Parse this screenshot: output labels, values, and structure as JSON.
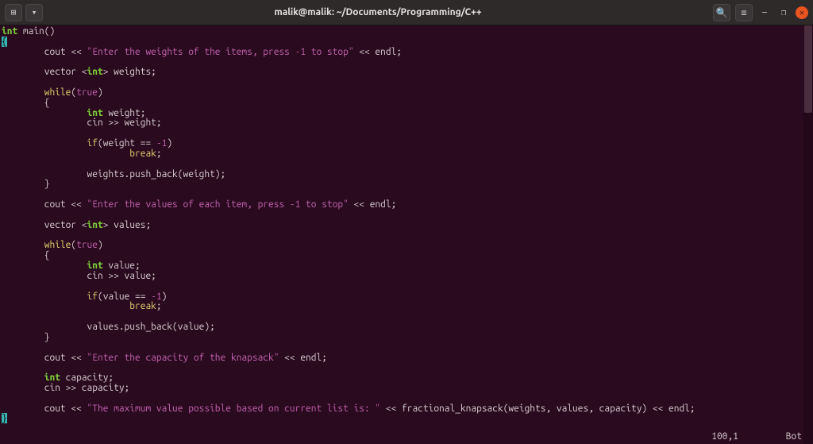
{
  "titlebar": {
    "title": "malik@malik: ~/Documents/Programming/C++",
    "new_tab_icon": "⊞",
    "dropdown_icon": "▾",
    "search_icon": "🔍",
    "menu_icon": "≡",
    "minimize_icon": "—",
    "maximize_icon": "❐",
    "close_icon": "✕"
  },
  "code": {
    "fn_sig_type": "int",
    "fn_sig_name": " main()",
    "open_brace": "{",
    "cout_kw": "        cout << ",
    "str1": "\"Enter the weights of the items, press -1 to stop\"",
    "endl_tail": " << endl;",
    "vec_decl_pre": "        vector <",
    "vec_int": "int",
    "vec_weights_post": "> weights;",
    "while_kw": "while",
    "while_pre": "        ",
    "while_open": "(",
    "true_kw": "true",
    "while_close": ")",
    "block_open": "        {",
    "int_weight_pre": "                ",
    "int_weight_name": " weight;",
    "cin_weight": "                cin >> weight;",
    "if_pre": "                ",
    "if_kw": "if",
    "if_weight_cond_open": "(weight == ",
    "neg1": "-1",
    "if_close": ")",
    "break_pre": "                        ",
    "break_kw": "break",
    "semi": ";",
    "push_weight": "                weights.push_back(weight);",
    "block_close": "        }",
    "str2": "\"Enter the values of each item, press -1 to stop\"",
    "vec_values_post": "> values;",
    "int_value_name": " value;",
    "cin_value": "                cin >> value;",
    "if_value_cond_open": "(value == ",
    "push_value": "                values.push_back(value);",
    "str3": "\"Enter the capacity of the knapsack\"",
    "int_cap_pre": "        ",
    "int_cap_name": " capacity;",
    "cin_cap": "        cin >> capacity;",
    "str4": "\"The maximum value possible based on current list is: \"",
    "final_tail": " << fractional_knapsack(weights, values, capacity) << endl;",
    "close_brace": "}"
  },
  "status": {
    "position": "100,1",
    "location": "Bot"
  }
}
